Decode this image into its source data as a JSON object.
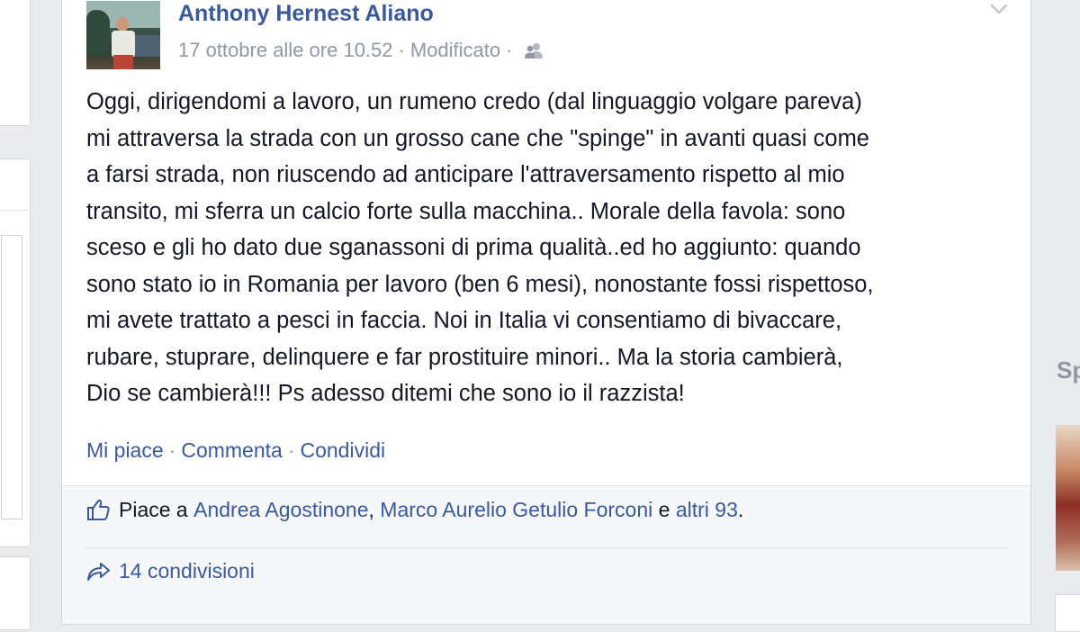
{
  "post": {
    "author": "Anthony Hernest Aliano",
    "date": "17 ottobre alle ore 10.52",
    "separator": "·",
    "edited": "Modificato",
    "text": "Oggi, dirigendomi a lavoro, un rumeno credo (dal linguaggio volgare pareva)\nmi attraversa la strada con un grosso cane che \"spinge\" in avanti quasi come\na farsi strada, non riuscendo ad anticipare l'attraversamento rispetto al mio\ntransito, mi sferra un calcio forte sulla macchina.. Morale della favola: sono\nsceso e gli ho dato due sganassoni di prima qualità..ed ho aggiunto: quando\nsono stato io in Romania per lavoro (ben 6 mesi), nonostante fossi rispettoso,\nmi avete trattato a pesci in faccia. Noi in Italia vi consentiamo di bivaccare,\nrubare, stuprare, delinquere e far prostituire minori.. Ma la storia cambierà,\nDio se cambierà!!! Ps adesso ditemi che sono io il razzista!",
    "actions": {
      "like": "Mi piace",
      "comment": "Commenta",
      "share": "Condividi",
      "dot": "·"
    }
  },
  "ufi": {
    "likes_prefix": "Piace a",
    "liker1": "Andrea Agostinone",
    "comma": ",",
    "liker2": "Marco Aurelio Getulio Forconi",
    "and": "e",
    "others": "altri 93",
    "period": ".",
    "shares": "14 condivisioni"
  },
  "right_sidebar": {
    "partial_title": "Sp"
  },
  "icons": {
    "audience": "friends-icon",
    "menu": "chevron-down-icon",
    "like": "thumbs-up-icon",
    "share": "share-arrow-icon"
  },
  "colors": {
    "link": "#3b5998",
    "meta": "#9197a3",
    "text": "#141823",
    "background": "#e9ebee"
  }
}
